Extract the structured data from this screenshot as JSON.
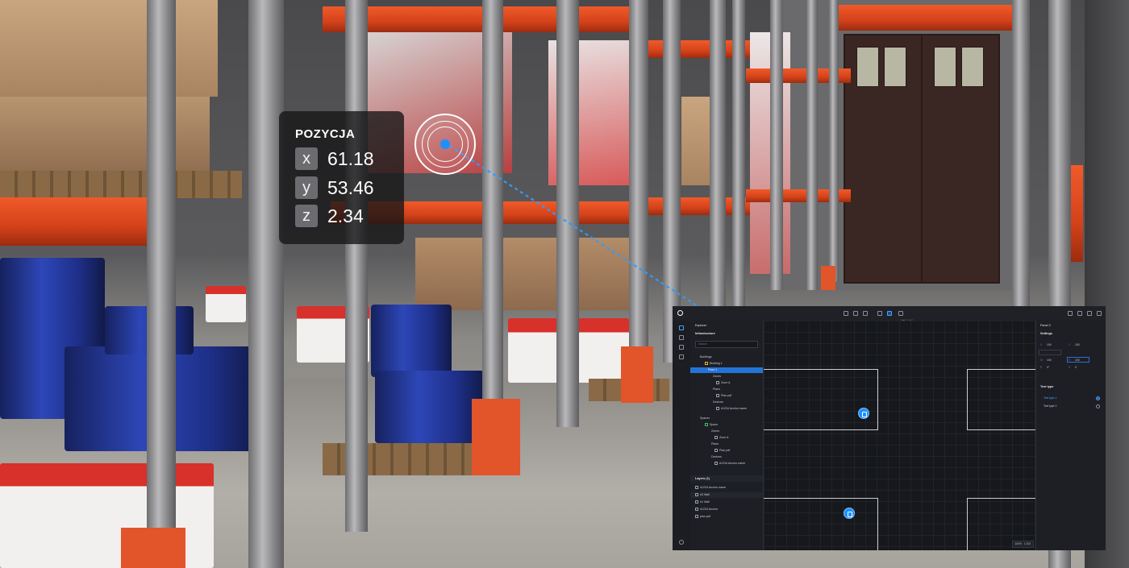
{
  "overlay": {
    "title": "POZYCJA",
    "coords": [
      {
        "axis": "x",
        "value": "61.18"
      },
      {
        "axis": "y",
        "value": "53.46"
      },
      {
        "axis": "z",
        "value": "2.34"
      }
    ],
    "accent_color": "#1e90ff"
  },
  "app": {
    "floor_tab": "Floor 1",
    "explorer": {
      "title": "Explorer",
      "section_infrastructure": "Infrastructure",
      "search_placeholder": "Search",
      "tree": [
        {
          "label": "Buildings"
        },
        {
          "label": "Building 1"
        },
        {
          "label": "Floor 1"
        },
        {
          "label": "Zones"
        },
        {
          "label": "Zone A"
        },
        {
          "label": "Plans"
        },
        {
          "label": "Plan.pdf"
        },
        {
          "label": "Devices"
        },
        {
          "label": "#1234 Anchor name"
        },
        {
          "label": "Spaces"
        },
        {
          "label": "Space"
        },
        {
          "label": "Zones"
        },
        {
          "label": "Zone A"
        },
        {
          "label": "Plans"
        },
        {
          "label": "Plan.pdf"
        },
        {
          "label": "Devices"
        },
        {
          "label": "#1234 Anchor name"
        }
      ],
      "section_layers": "Layers (1)",
      "layers": [
        {
          "label": "#1234 Anchor name"
        },
        {
          "label": "#3 Wall"
        },
        {
          "label": "#1 Wall"
        },
        {
          "label": "#1234 Anchor"
        },
        {
          "label": "plan.pdf"
        }
      ]
    },
    "canvas": {
      "zoom": "100%",
      "page": "1:100"
    },
    "properties": {
      "title": "Panel 2",
      "settings_label": "Settings",
      "fields": {
        "x_label": "X",
        "x_value": "100",
        "y_label": "Y",
        "y_value": "100",
        "w_label": "W",
        "w_value": "100",
        "h_label": "H",
        "h_value": "100",
        "r_label": "R",
        "r_value": "0°",
        "s_label": "S",
        "s_value": "0"
      },
      "text_type_label": "Text type",
      "options": [
        {
          "label": "Text type 1",
          "selected": true
        },
        {
          "label": "Text type 2",
          "selected": false
        }
      ]
    }
  }
}
